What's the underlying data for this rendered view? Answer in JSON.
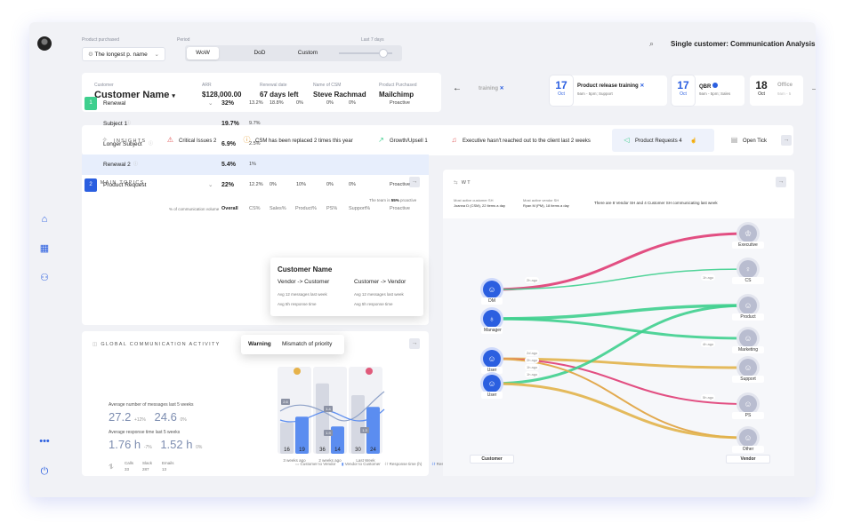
{
  "colors": {
    "accent": "#2b5fe0",
    "pink": "#e03c74",
    "green": "#3fcf8e",
    "gold": "#e2b24a",
    "bar_light": "#d5d8e2",
    "bar_blue": "#5b8df0"
  },
  "topbar": {
    "product_label": "Product purchased",
    "product_value": "The longest p. name",
    "period_label": "Period",
    "seg_wow": "WoW",
    "seg_dod": "DoD",
    "seg_custom": "Custom",
    "last_days": "Last 7 days",
    "analysis_title": "Single customer: Communication Analysis"
  },
  "header": {
    "customer_label": "Customer",
    "customer_name": "Customer Name",
    "arr_label": "ARR",
    "arr_value": "$128,000.00",
    "renewal_label": "Renewal date",
    "renewal_value": "67 days left",
    "csm_label": "Name of CSM",
    "csm_value": "Steve Rachmad",
    "prod_label": "Product Purchased",
    "prod_value": "Mailchimp"
  },
  "events": [
    {
      "day": "",
      "month": "",
      "title": "training",
      "sub": ""
    },
    {
      "day": "17",
      "month": "Oct",
      "title": "Product release training",
      "sub": "9am - 5pm; Support"
    },
    {
      "day": "17",
      "month": "Oct",
      "title": "QBR",
      "sub": "9am - 5pm; Sales"
    },
    {
      "day": "18",
      "month": "Oct",
      "title": "Office",
      "sub": "9am - 5"
    }
  ],
  "insights": {
    "label": "INSIGHTS",
    "items": [
      "Critical Issues 2",
      "CSM has been replaced 2 times this year",
      "Growth/Upsell 1",
      "Executive hasn't reached out to the client last 2 weeks",
      "Product Requests 4",
      "Open Tick"
    ]
  },
  "topics": {
    "title": "MAIN TOPICS",
    "note_pre": "The team is ",
    "note_pct": "55%",
    "note_post": " proactive",
    "vol_label": "% of communication volume",
    "cols": [
      "Overall",
      "CS%",
      "Sales%",
      "Product%",
      "PS%",
      "Support%",
      "Proactive"
    ],
    "rows": [
      {
        "num": "1",
        "name": "Renewal",
        "overall": "32%",
        "cs": "13.2%",
        "sales": "18.8%",
        "product": "0%",
        "ps": "0%",
        "support": "0%",
        "proactive": "Proactive"
      },
      {
        "num": "",
        "name": "Subject 1",
        "overall": "19.7%",
        "cs": "9.7%",
        "sales": "",
        "product": "",
        "ps": "",
        "support": "",
        "proactive": ""
      },
      {
        "num": "",
        "name": "Longer Subject",
        "overall": "6.9%",
        "cs": "2.5%",
        "sales": "",
        "product": "",
        "ps": "",
        "support": "",
        "proactive": ""
      },
      {
        "num": "",
        "name": "Renewal 2",
        "overall": "5.4%",
        "cs": "1%",
        "sales": "",
        "product": "",
        "ps": "",
        "support": "",
        "proactive": ""
      },
      {
        "num": "2",
        "name": "Product Request",
        "overall": "22%",
        "cs": "12.2%",
        "sales": "0%",
        "product": "10%",
        "ps": "0%",
        "support": "0%",
        "proactive": "Proactive"
      }
    ],
    "popup": {
      "title": "Customer Name",
      "a": "Vendor -> Customer",
      "b": "Customer -> Vendor",
      "a1": "Avg 12 messages last week",
      "a2": "Avg 5h response time",
      "b1": "Avg 12 messages last week",
      "b2": "Avg 5h response time"
    }
  },
  "comm": {
    "title": "GLOBAL COMMUNICATION ACTIVITY",
    "tab_warning": "Warning",
    "tab_mismatch": "Mismatch of priority",
    "avg_msg_label": "Average number of messages last 5 weeks",
    "msg_a": "27.2",
    "msg_a_d": "+12%",
    "msg_b": "24.6",
    "msg_b_d": "0%",
    "avg_resp_label": "Average response time last 5 weeks",
    "resp_a": "1.76 h",
    "resp_a_d": "-7%",
    "resp_b": "1.52 h",
    "resp_b_d": "0%",
    "calls_label": "Calls",
    "calls": "33",
    "slack_label": "Slack",
    "slack": "287",
    "emails_label": "Emails",
    "emails": "13",
    "bars": [
      {
        "a": 16,
        "b": 19
      },
      {
        "a": 36,
        "b": 14
      },
      {
        "a": 30,
        "b": 24
      }
    ],
    "bar_labels": [
      "16",
      "19",
      "36",
      "14",
      "30",
      "24"
    ],
    "week_labels": [
      "3 weeks ago",
      "2 weeks ago",
      "Last Week"
    ],
    "resp_labels": [
      "2.6",
      "1.4",
      "1.9",
      "1.3"
    ],
    "legend": [
      "Customer to Vendor",
      "Vendor to Customer",
      "Response time (h)",
      "Response time (h)"
    ]
  },
  "network": {
    "title": "WT",
    "info1_label": "Most active customer SH",
    "info1_value": "Joanna D (CSM), 22 items a day",
    "info2_label": "Most active vendor SH",
    "info2_value": "Ryan M (PM), 18 items a day",
    "info3": "There are 8 Vendor SH and 4 Customer SH communicating last week",
    "customer_nodes": [
      "DM",
      "Manager",
      "User",
      "User"
    ],
    "vendor_nodes": [
      "Executive",
      "CS",
      "Product",
      "Marketing",
      "Support",
      "PS",
      "Other"
    ],
    "ago": [
      "2h ago",
      "1h ago",
      "4h ago",
      "2d ago",
      "1h ago",
      "1h ago",
      "5h ago",
      "2h ago"
    ],
    "customer_label": "Customer",
    "vendor_label": "Vendor"
  }
}
